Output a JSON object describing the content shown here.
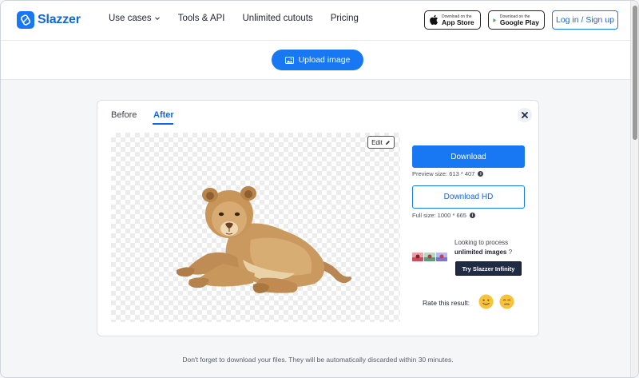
{
  "brand": {
    "name": "Slazzer",
    "accent": "#1877f2"
  },
  "nav": {
    "items": [
      {
        "label": "Use cases",
        "has_dropdown": true
      },
      {
        "label": "Tools & API"
      },
      {
        "label": "Unlimited cutouts"
      },
      {
        "label": "Pricing"
      }
    ]
  },
  "stores": {
    "apple": {
      "small": "Download on the",
      "big": "App Store"
    },
    "google": {
      "small": "Download on the",
      "big": "Google Play"
    }
  },
  "auth": {
    "login_label": "Log in / Sign up"
  },
  "upload": {
    "label": "Upload image"
  },
  "card": {
    "tabs": [
      {
        "label": "Before"
      },
      {
        "label": "After"
      }
    ],
    "active_tab": "After",
    "edit_label": "Edit",
    "download_label": "Download",
    "preview_size": "Preview size: 613 * 407",
    "download_hd_label": "Download HD",
    "full_size": "Full size: 1000 * 665",
    "promo_line1": "Looking to process",
    "promo_line2_bold": "unlimited images",
    "promo_line2_suffix": "?",
    "infinity_label": "Try Slazzer Infinity",
    "rate_label": "Rate this result:"
  },
  "footer": {
    "note": "Don't forget to download your files. They will be automatically discarded within 30 minutes."
  },
  "icons": [
    "logo-icon",
    "chevron-down-icon",
    "apple-icon",
    "google-play-icon",
    "image-icon",
    "close-icon",
    "pencil-icon",
    "info-icon",
    "happy-face-icon",
    "meh-face-icon"
  ]
}
